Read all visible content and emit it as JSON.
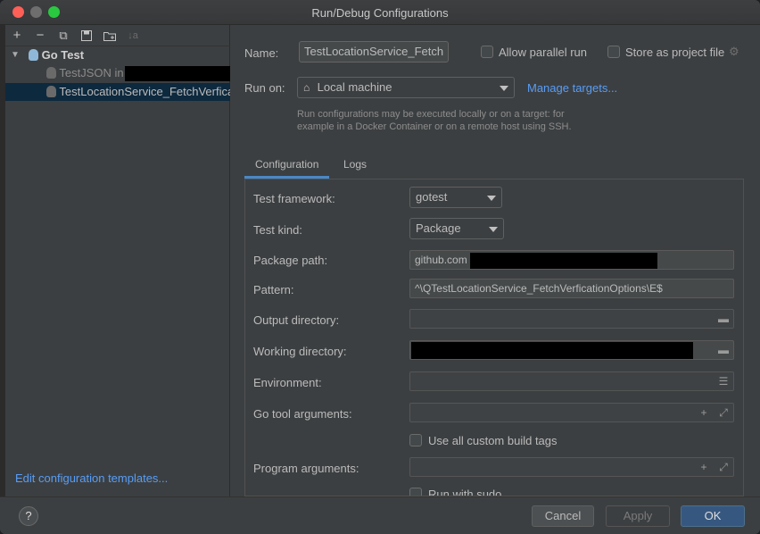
{
  "window": {
    "title": "Run/Debug Configurations"
  },
  "toolbar": {
    "add": "+",
    "remove": "−",
    "copy": "⧉",
    "save": "🖫",
    "folder": "▣",
    "sort": "↓a"
  },
  "tree": {
    "group_label": "Go Test",
    "items": [
      {
        "label": "TestJSON in "
      },
      {
        "label": "TestLocationService_FetchVerfication"
      }
    ]
  },
  "edit_templates_label": "Edit configuration templates...",
  "form": {
    "name_label": "Name:",
    "name_value": "TestLocationService_Fetch",
    "allow_parallel_label": "Allow parallel run",
    "store_as_project_label": "Store as project file",
    "run_on_label": "Run on:",
    "run_on_value": "Local machine",
    "manage_targets_label": "Manage targets...",
    "run_on_hint_line1": "Run configurations may be executed locally or on a target: for",
    "run_on_hint_line2": "example in a Docker Container or on a remote host using SSH."
  },
  "tabs": [
    {
      "label": "Configuration"
    },
    {
      "label": "Logs"
    }
  ],
  "config": {
    "test_framework_label": "Test framework:",
    "test_framework_value": "gotest",
    "test_kind_label": "Test kind:",
    "test_kind_value": "Package",
    "package_path_label": "Package path:",
    "package_path_value": "github.com",
    "pattern_label": "Pattern:",
    "pattern_value": "^\\QTestLocationService_FetchVerficationOptions\\E$",
    "output_dir_label": "Output directory:",
    "working_dir_label": "Working directory:",
    "environment_label": "Environment:",
    "go_tool_args_label": "Go tool arguments:",
    "use_custom_tags_label": "Use all custom build tags",
    "program_args_label": "Program arguments:",
    "run_with_sudo_label": "Run with sudo"
  },
  "buttons": {
    "help": "?",
    "cancel": "Cancel",
    "apply": "Apply",
    "ok": "OK"
  },
  "colors": {
    "background": "#3c3f41",
    "accent": "#365880",
    "link": "#589df6",
    "selection": "#0d293e"
  }
}
